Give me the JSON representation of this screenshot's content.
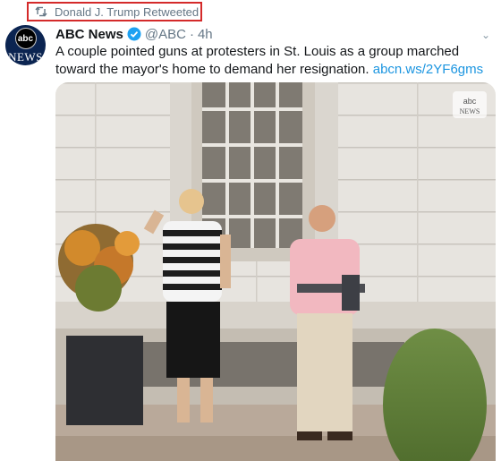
{
  "retweet": {
    "label": "Donald J. Trump Retweeted",
    "icon": "retweet-icon"
  },
  "author": {
    "name": "ABC News",
    "handle": "@ABC",
    "separator": "·",
    "time": "4h",
    "avatar_text": "abc",
    "avatar_sub": "NEWS"
  },
  "tweet": {
    "text": "A couple pointed guns at protesters in St. Louis as a group marched toward the mayor's home to demand her resignation.",
    "link": "abcn.ws/2YF6gms"
  },
  "media": {
    "watermark_top": "abc",
    "watermark_bottom": "NEWS"
  },
  "colors": {
    "accent": "#1b95e0",
    "highlight_box": "#d42a2a",
    "muted": "#657786"
  }
}
